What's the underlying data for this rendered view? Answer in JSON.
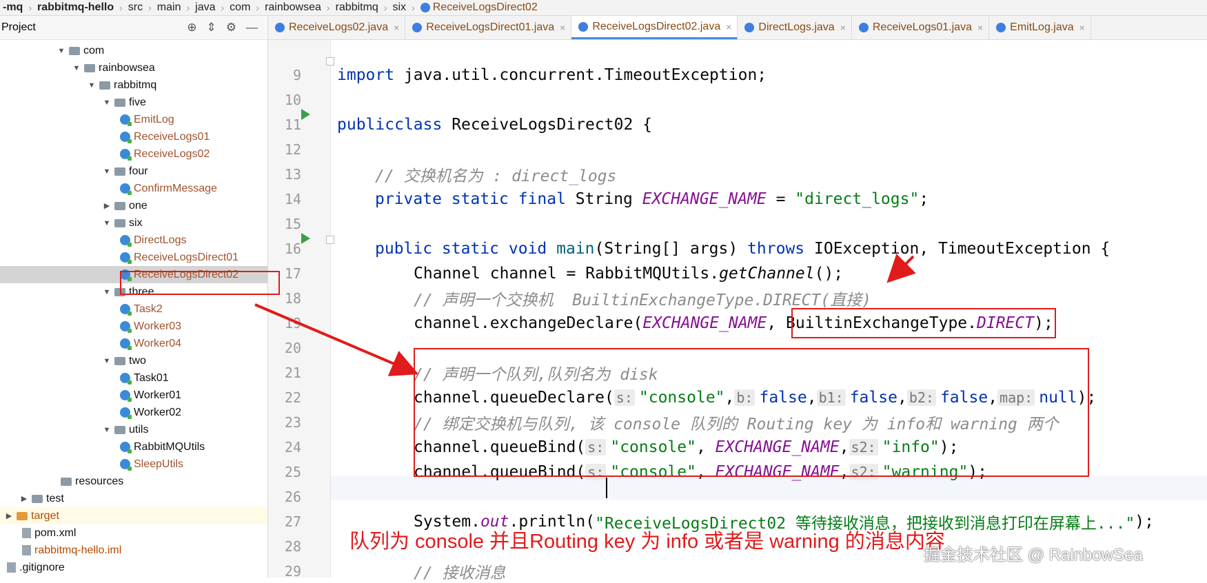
{
  "breadcrumb": [
    "-mq",
    "rabbitmq-hello",
    "src",
    "main",
    "java",
    "com",
    "rainbowsea",
    "rabbitmq",
    "six",
    "ReceiveLogsDirect02"
  ],
  "project_panel": {
    "title": "Project",
    "tree": [
      {
        "label": "com",
        "type": "folder",
        "expanded": true
      },
      {
        "label": "rainbowsea",
        "type": "folder",
        "expanded": true
      },
      {
        "label": "rabbitmq",
        "type": "folder",
        "expanded": true
      },
      {
        "label": "five",
        "type": "folder",
        "expanded": true
      },
      {
        "label": "EmitLog",
        "type": "class"
      },
      {
        "label": "ReceiveLogs01",
        "type": "class"
      },
      {
        "label": "ReceiveLogs02",
        "type": "class"
      },
      {
        "label": "four",
        "type": "folder",
        "expanded": true
      },
      {
        "label": "ConfirmMessage",
        "type": "class"
      },
      {
        "label": "one",
        "type": "folder",
        "expanded": false
      },
      {
        "label": "six",
        "type": "folder",
        "expanded": true
      },
      {
        "label": "DirectLogs",
        "type": "class"
      },
      {
        "label": "ReceiveLogsDirect01",
        "type": "class"
      },
      {
        "label": "ReceiveLogsDirect02",
        "type": "class",
        "selected": true
      },
      {
        "label": "three",
        "type": "folder",
        "expanded": true
      },
      {
        "label": "Task2",
        "type": "class"
      },
      {
        "label": "Worker03",
        "type": "class"
      },
      {
        "label": "Worker04",
        "type": "class"
      },
      {
        "label": "two",
        "type": "folder",
        "expanded": true
      },
      {
        "label": "Task01",
        "type": "class"
      },
      {
        "label": "Worker01",
        "type": "class"
      },
      {
        "label": "Worker02",
        "type": "class"
      },
      {
        "label": "utils",
        "type": "folder",
        "expanded": true
      },
      {
        "label": "RabbitMQUtils",
        "type": "class"
      },
      {
        "label": "SleepUtils",
        "type": "class"
      },
      {
        "label": "resources",
        "type": "folder"
      },
      {
        "label": "test",
        "type": "folder",
        "expanded": false
      },
      {
        "label": "target",
        "type": "folder",
        "expanded": false
      },
      {
        "label": "pom.xml",
        "type": "file"
      },
      {
        "label": "rabbitmq-hello.iml",
        "type": "file"
      },
      {
        "label": ".gitignore",
        "type": "file"
      }
    ]
  },
  "tabs": [
    {
      "label": "ReceiveLogs02.java",
      "active": false
    },
    {
      "label": "ReceiveLogsDirect01.java",
      "active": false
    },
    {
      "label": "ReceiveLogsDirect02.java",
      "active": true
    },
    {
      "label": "DirectLogs.java",
      "active": false
    },
    {
      "label": "ReceiveLogs01.java",
      "active": false
    },
    {
      "label": "EmitLog.java",
      "active": false
    }
  ],
  "code": {
    "line_numbers": [
      "9",
      "10",
      "11",
      "12",
      "13",
      "14",
      "15",
      "16",
      "17",
      "18",
      "19",
      "20",
      "21",
      "22",
      "23",
      "24",
      "25",
      "26",
      "27",
      "28",
      "29"
    ],
    "l9": {
      "kw": "import",
      "rest": " java.util.concurrent.TimeoutException;"
    },
    "l11": {
      "kw1": "public",
      "kw2": "class",
      "rest": " ReceiveLogsDirect02 {"
    },
    "l13": "// 交换机名为 : direct_logs",
    "l14": {
      "kw": "private static final",
      "type": " String ",
      "const": "EXCHANGE_NAME",
      "eq": " = ",
      "str": "\"direct_logs\"",
      "end": ";"
    },
    "l16": {
      "kw1": "public static void",
      "name": " main",
      "params": "(String[] args) ",
      "kw2": "throws",
      "rest": " IOException, TimeoutException {"
    },
    "l17": {
      "pre": "Channel channel = RabbitMQUtils.",
      "method": "getChannel",
      "post": "();"
    },
    "l18": "// 声明一个交换机  BuiltinExchangeType.DIRECT(直接)",
    "l19": {
      "pre": "channel.exchangeDeclare(",
      "const": "EXCHANGE_NAME",
      "mid": ", BuiltinExchangeType.",
      "const2": "DIRECT",
      "post": ");"
    },
    "l21": "// 声明一个队列,队列名为 disk",
    "l22": {
      "pre": "channel.queueDeclare(",
      "h1": "s:",
      "s1": "\"console\"",
      "c1": ",",
      "h2": "b:",
      "v2": "false",
      "c2": ",",
      "h3": "b1:",
      "v3": "false",
      "c3": ",",
      "h4": "b2:",
      "v4": "false",
      "c4": ",",
      "h5": "map:",
      "v5": "null",
      "end": ");"
    },
    "l23": "// 绑定交换机与队列, 该 console 队列的 Routing key 为 info和 warning 两个",
    "l24": {
      "pre": "channel.queueBind(",
      "h1": "s:",
      "s1": "\"console\"",
      "c1": ", ",
      "const": "EXCHANGE_NAME",
      "c2": ",",
      "h2": "s2:",
      "s2": "\"info\"",
      "end": ");"
    },
    "l25": {
      "pre": "channel.queueBind(",
      "h1": "s:",
      "s1": "\"console\"",
      "c1": ", ",
      "const": "EXCHANGE_NAME",
      "c2": ",",
      "h2": "s2:",
      "s2": "\"warning\"",
      "end": ");"
    },
    "l27": {
      "pre": "System.",
      "field": "out",
      "mid": ".println(",
      "str": "\"ReceiveLogsDirect02 等待接收消息，把接收到消息打印在屏幕上...\"",
      "end": ");"
    },
    "l29": "// 接收消息"
  },
  "annotation_text": "队列为 console  并且Routing key 为 info 或者是 warning 的消息内容",
  "watermark": "掘金技术社区 @ RainbowSea",
  "colors": {
    "annotation_red": "#e01b1b",
    "keyword": "#0033b3",
    "string": "#067d17",
    "constant": "#871094",
    "comment": "#8c8c8c"
  }
}
